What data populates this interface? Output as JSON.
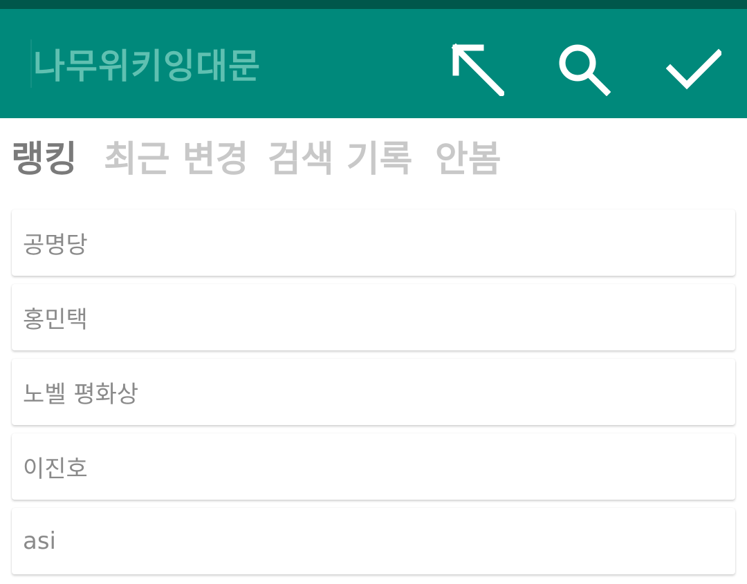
{
  "toolbar": {
    "search_text": "나무위키잉대문",
    "back_icon": "arrow-up-left-icon",
    "search_icon": "search-icon",
    "done_icon": "check-icon",
    "background_color": "#00897b",
    "status_bar_color": "#00574b"
  },
  "tabs": [
    {
      "label": "랭킹",
      "active": true
    },
    {
      "label": "최근 변경",
      "active": false
    },
    {
      "label": "검색 기록",
      "active": false
    },
    {
      "label": "안봄",
      "active": false
    }
  ],
  "list": {
    "items": [
      {
        "label": "공명당"
      },
      {
        "label": "홍민택"
      },
      {
        "label": "노벨 평화상"
      },
      {
        "label": "이진호"
      },
      {
        "label": "asi"
      }
    ]
  }
}
